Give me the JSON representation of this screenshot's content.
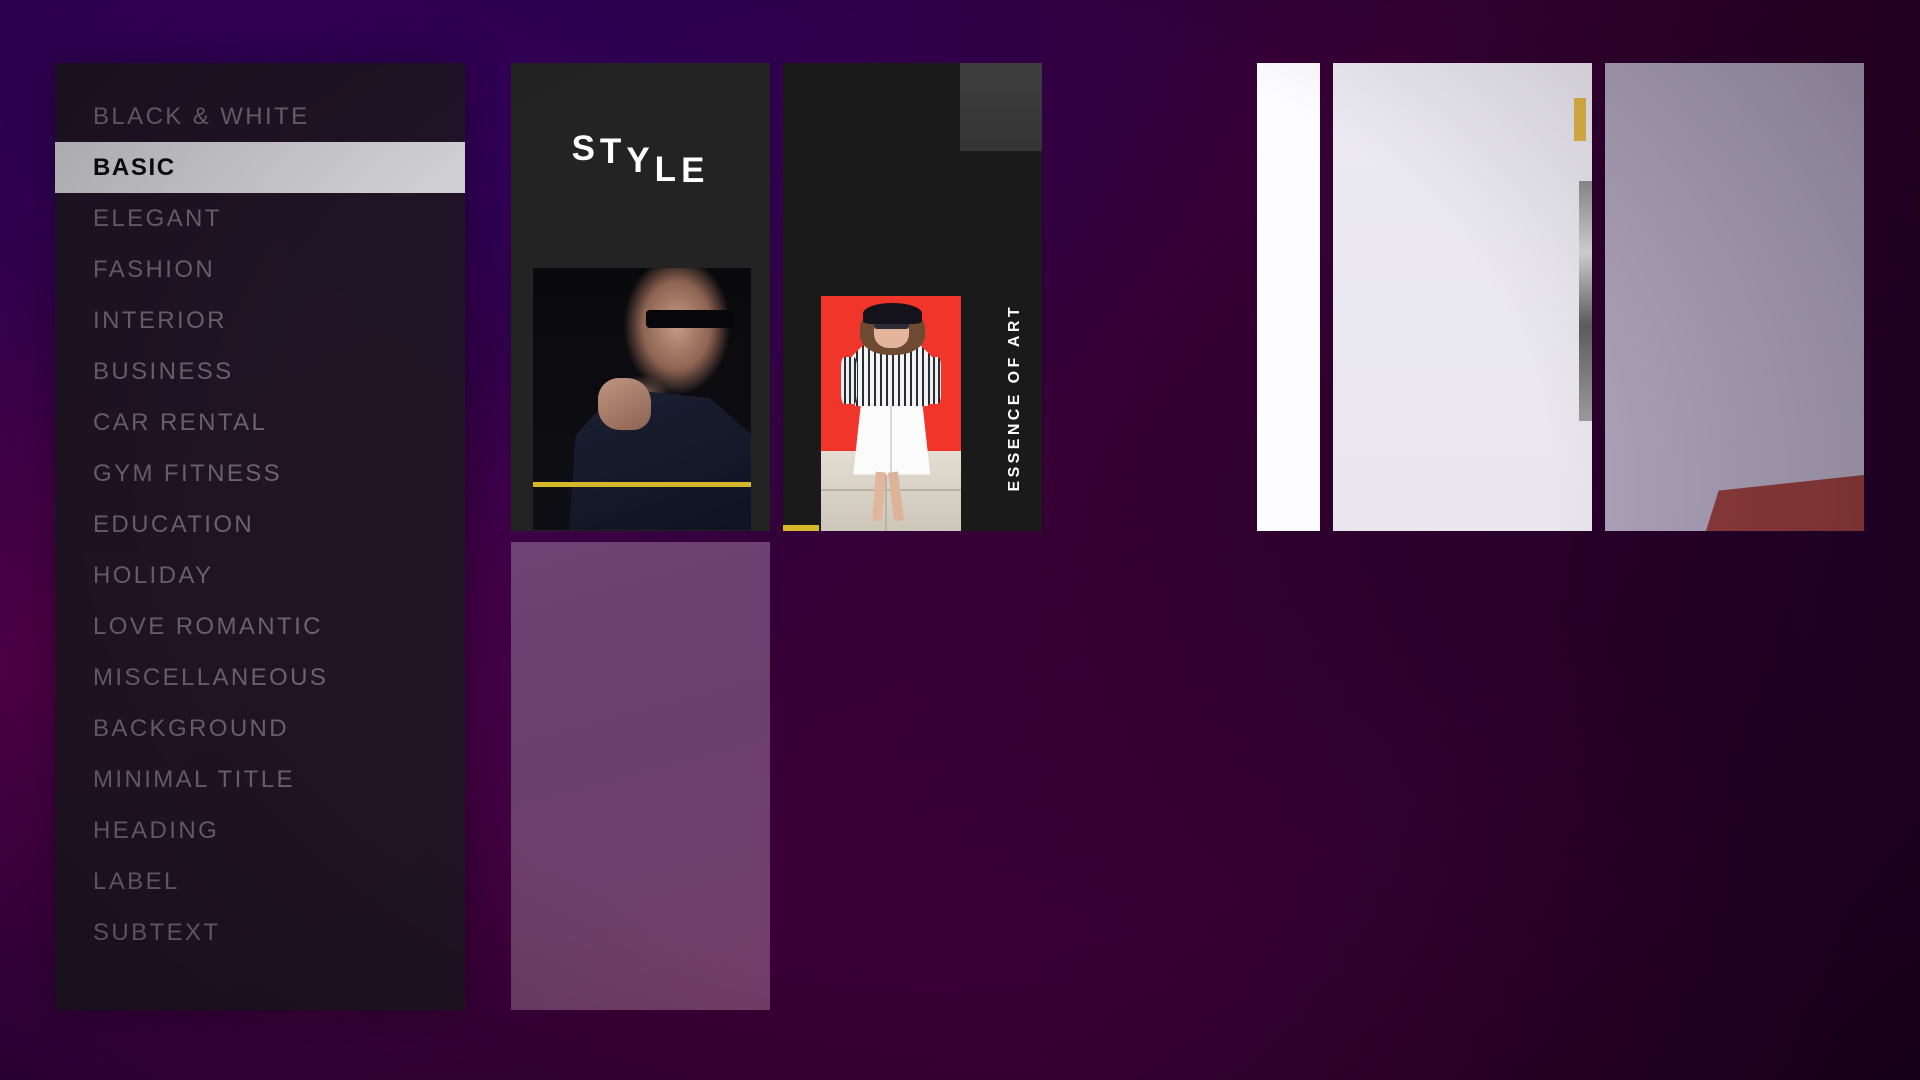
{
  "background": {
    "gradient_from": "#36005e",
    "gradient_mid": "#360034",
    "gradient_to": "#1e001f"
  },
  "sidebar": {
    "selected_index": 1,
    "highlight_color": "#cfcfd4",
    "text_color": "#6d6472",
    "items": [
      {
        "label": "BLACK & WHITE"
      },
      {
        "label": "BASIC"
      },
      {
        "label": "ELEGANT"
      },
      {
        "label": "FASHION"
      },
      {
        "label": "INTERIOR"
      },
      {
        "label": "BUSINESS"
      },
      {
        "label": "CAR RENTAL"
      },
      {
        "label": "GYM FITNESS"
      },
      {
        "label": "EDUCATION"
      },
      {
        "label": "HOLIDAY"
      },
      {
        "label": "LOVE ROMANTIC"
      },
      {
        "label": "MISCELLANEOUS"
      },
      {
        "label": "BACKGROUND"
      },
      {
        "label": "MINIMAL TITLE"
      },
      {
        "label": "HEADING"
      },
      {
        "label": "LABEL"
      },
      {
        "label": "SUBTEXT"
      }
    ]
  },
  "cards": {
    "style": {
      "title_letters": [
        "S",
        "T",
        "Y",
        "L",
        "E"
      ],
      "title": "STYLE",
      "background_color": "#232323",
      "accent_color": "#d4b82a"
    },
    "essence": {
      "label": "ESSENCE OF ART",
      "background_color": "#1a1a1a",
      "accent_color": "#d4b82a"
    },
    "placeholder": {
      "background_color": "#6e4272"
    },
    "white_slim": {
      "background_color": "#fdfdff"
    },
    "blank": {
      "background_color": "#eceaf1",
      "accent_color": "#e0b747"
    },
    "lavender": {
      "background_color": "#ada3ba",
      "shape_color": "#8e3b3b"
    }
  }
}
